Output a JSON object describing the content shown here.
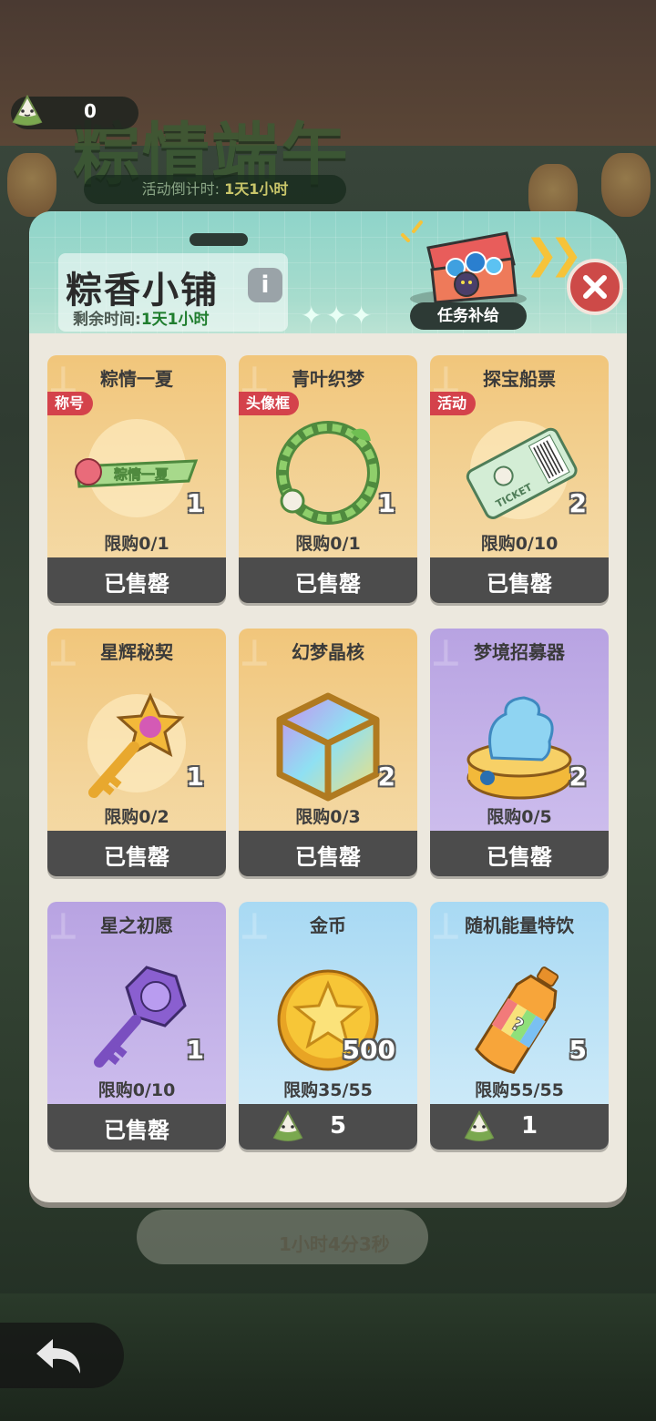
{
  "background": {
    "event_title": "粽情端午",
    "countdown_label": "活动倒计时:",
    "countdown_value": "1天1小时",
    "lower_timer": "1小时4分3秒"
  },
  "currency": {
    "icon": "zongzi-icon",
    "value": "0"
  },
  "shop": {
    "title": "粽香小铺",
    "info_icon": "i",
    "remain_label": "剩余时间:",
    "remain_value": "1天1小时",
    "task_supply_label": "任务补给"
  },
  "items": [
    {
      "name": "粽情一夏",
      "tag": "称号",
      "qty": "1",
      "limit": "限购0/1",
      "status": "已售罄",
      "theme": "gold",
      "icon": "title-badge-icon",
      "badge_text": "粽情一夏"
    },
    {
      "name": "青叶织梦",
      "tag": "头像框",
      "qty": "1",
      "limit": "限购0/1",
      "status": "已售罄",
      "theme": "gold",
      "icon": "leaf-wreath-frame-icon"
    },
    {
      "name": "探宝船票",
      "tag": "活动",
      "qty": "2",
      "limit": "限购0/10",
      "status": "已售罄",
      "theme": "gold",
      "icon": "ticket-icon",
      "ticket_text": "TICKET"
    },
    {
      "name": "星辉秘契",
      "qty": "1",
      "limit": "限购0/2",
      "status": "已售罄",
      "theme": "gold",
      "icon": "star-key-icon"
    },
    {
      "name": "幻梦晶核",
      "qty": "2",
      "limit": "限购0/3",
      "status": "已售罄",
      "theme": "gold",
      "icon": "crystal-cube-icon"
    },
    {
      "name": "梦境招募器",
      "qty": "2",
      "limit": "限购0/5",
      "status": "已售罄",
      "theme": "purple",
      "icon": "recruiter-icon"
    },
    {
      "name": "星之初愿",
      "qty": "1",
      "limit": "限购0/10",
      "status": "已售罄",
      "theme": "purple",
      "icon": "purple-key-icon"
    },
    {
      "name": "金币",
      "qty": "500",
      "limit": "限购35/55",
      "price": "5",
      "theme": "blue",
      "icon": "gold-coin-icon"
    },
    {
      "name": "随机能量特饮",
      "qty": "5",
      "limit": "限购55/55",
      "price": "1",
      "theme": "blue",
      "icon": "energy-drink-icon"
    }
  ],
  "colors": {
    "sold_bar": "#4c4c4c",
    "tag_red": "#d4424b",
    "close_red": "#cd4a48",
    "header_teal": "#8ed4c9"
  }
}
